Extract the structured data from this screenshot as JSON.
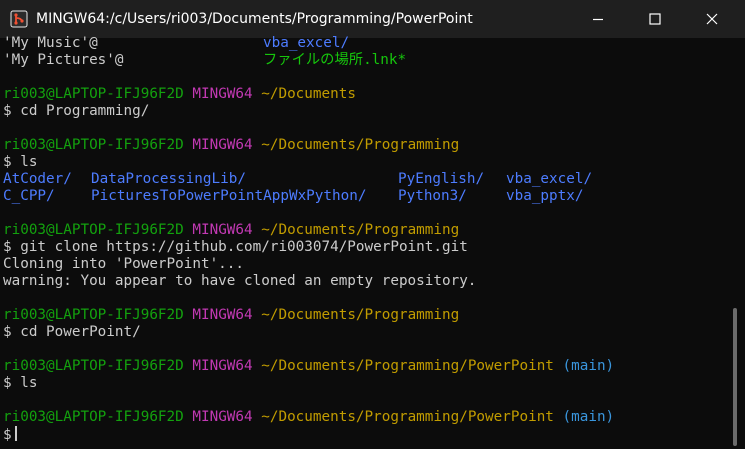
{
  "window": {
    "title": "MINGW64:/c/Users/ri003/Documents/Programming/PowerPoint",
    "icon": "git-bash-icon",
    "colors": {
      "user_host": "#13a10e",
      "mingw": "#c239b3",
      "path": "#c19c00",
      "branch": "#3a96dd"
    }
  },
  "terminal": {
    "ls_top": {
      "row1": {
        "left": "'My Music'@",
        "right": "vba_excel/"
      },
      "row2": {
        "left": "'My Pictures'@",
        "right": "ファイルの場所.lnk*"
      }
    },
    "block1": {
      "user": "ri003@LAPTOP-IFJ96F2D",
      "env": "MINGW64",
      "path": "~/Documents",
      "command": "$ cd Programming/"
    },
    "block2": {
      "user": "ri003@LAPTOP-IFJ96F2D",
      "env": "MINGW64",
      "path": "~/Documents/Programming",
      "command": "$ ls",
      "dirs_row1": [
        "AtCoder/",
        "DataProcessingLib/",
        "PyEnglish/",
        "vba_excel/"
      ],
      "dirs_row2": [
        "C_CPP/",
        "PicturesToPowerPointAppWxPython/",
        "Python3/",
        "vba_pptx/"
      ]
    },
    "block3": {
      "user": "ri003@LAPTOP-IFJ96F2D",
      "env": "MINGW64",
      "path": "~/Documents/Programming",
      "command": "$ git clone https://github.com/ri003074/PowerPoint.git",
      "out1": "Cloning into 'PowerPoint'...",
      "out2": "warning: You appear to have cloned an empty repository."
    },
    "block4": {
      "user": "ri003@LAPTOP-IFJ96F2D",
      "env": "MINGW64",
      "path": "~/Documents/Programming",
      "command": "$ cd PowerPoint/"
    },
    "block5": {
      "user": "ri003@LAPTOP-IFJ96F2D",
      "env": "MINGW64",
      "path": "~/Documents/Programming/PowerPoint",
      "branch": "(main)",
      "command": "$ ls"
    },
    "block6": {
      "user": "ri003@LAPTOP-IFJ96F2D",
      "env": "MINGW64",
      "path": "~/Documents/Programming/PowerPoint",
      "branch": "(main)",
      "command": "$"
    }
  }
}
